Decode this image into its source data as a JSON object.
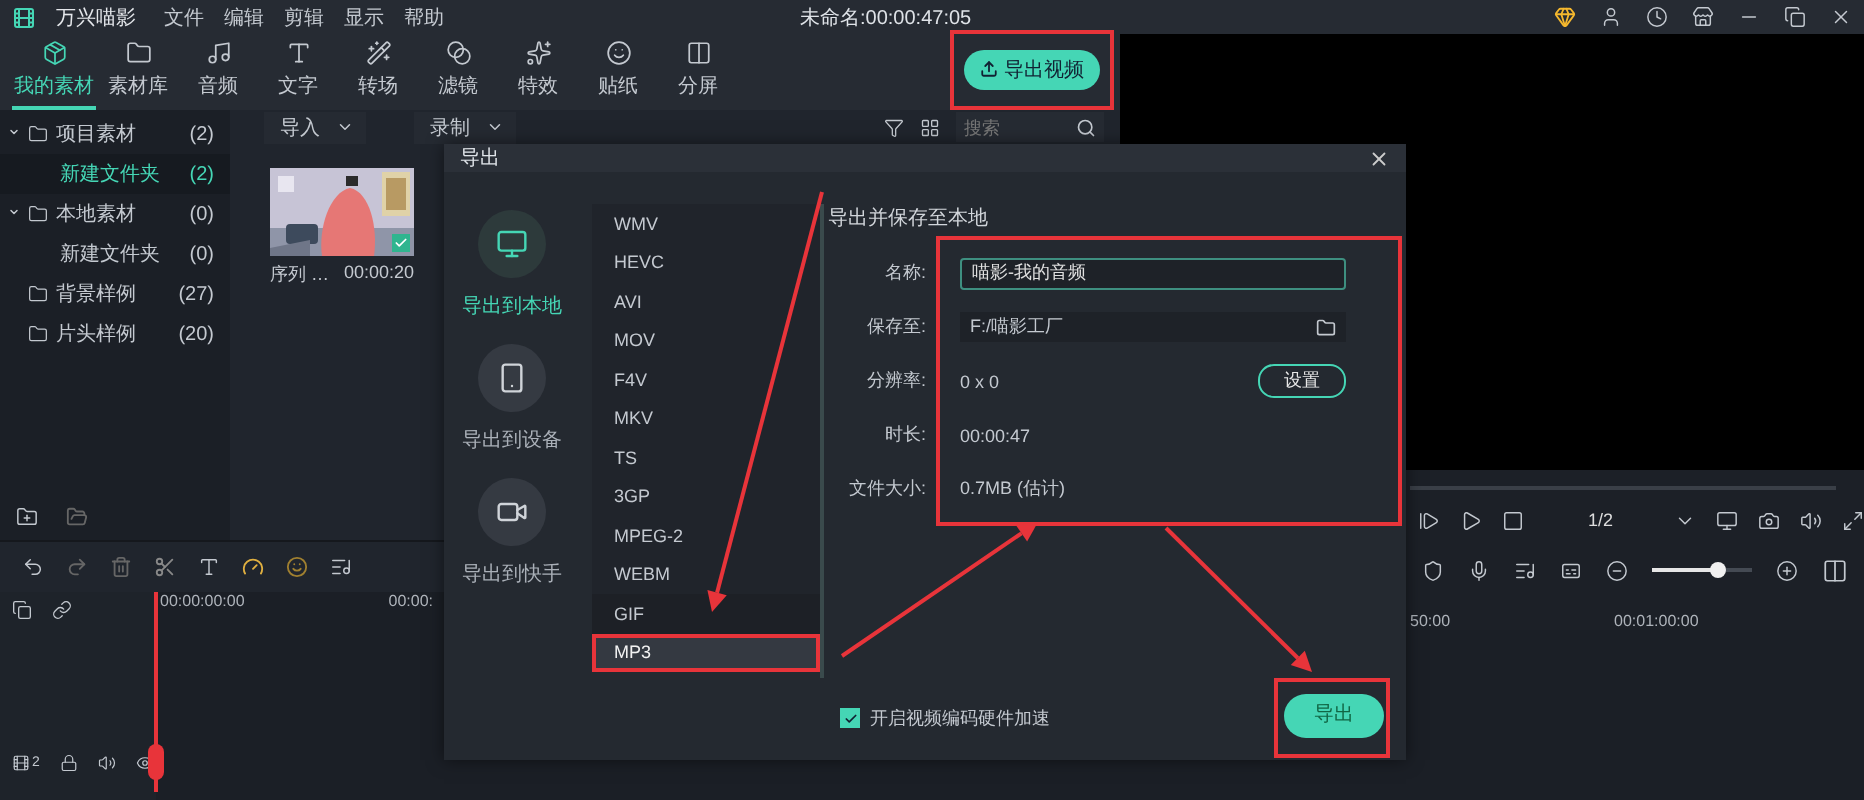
{
  "app": {
    "name": "万兴喵影",
    "menus": [
      "文件",
      "编辑",
      "剪辑",
      "显示",
      "帮助"
    ],
    "title": "未命名:00:00:47:05"
  },
  "toolbar": {
    "tabs": [
      {
        "label": "我的素材",
        "selected": true,
        "kind": "media"
      },
      {
        "label": "素材库",
        "selected": false,
        "kind": "library"
      },
      {
        "label": "音频",
        "selected": false,
        "kind": "audio"
      },
      {
        "label": "文字",
        "selected": false,
        "kind": "text"
      },
      {
        "label": "转场",
        "selected": false,
        "kind": "transition"
      },
      {
        "label": "滤镜",
        "selected": false,
        "kind": "filter"
      },
      {
        "label": "特效",
        "selected": false,
        "kind": "effect"
      },
      {
        "label": "贴纸",
        "selected": false,
        "kind": "sticker"
      },
      {
        "label": "分屏",
        "selected": false,
        "kind": "split"
      }
    ],
    "export_button": {
      "label": "导出视频",
      "highlighted": true
    }
  },
  "sidebar": {
    "items": [
      {
        "label": "项目素材",
        "count": "(2)",
        "expanded": true,
        "selected": false,
        "children": [
          {
            "label": "新建文件夹",
            "count": "(2)",
            "selected": true
          }
        ]
      },
      {
        "label": "本地素材",
        "count": "(0)",
        "expanded": true,
        "selected": false,
        "children": [
          {
            "label": "新建文件夹",
            "count": "(0)",
            "selected": false
          }
        ]
      },
      {
        "label": "背景样例",
        "count": "(27)",
        "expanded": false,
        "selected": false
      },
      {
        "label": "片头样例",
        "count": "(20)",
        "expanded": false,
        "selected": false
      }
    ]
  },
  "media": {
    "import": "导入",
    "record": "录制",
    "search": {
      "placeholder": "搜索"
    },
    "clips": [
      {
        "name": "序列 …",
        "duration": "00:00:20",
        "checked": true
      }
    ]
  },
  "timeline": {
    "ruler_left": [
      "00:00:00:00",
      "00:00:"
    ],
    "ruler_right": [
      "50:00",
      "00:01:00:00"
    ],
    "track_badge": "2"
  },
  "player": {
    "page": "1/2",
    "zoom": {
      "level": 0.65
    }
  },
  "dialog": {
    "title": "导出",
    "destinations": [
      {
        "label": "导出到本地",
        "selected": true,
        "kind": "local"
      },
      {
        "label": "导出到设备",
        "selected": false,
        "kind": "device"
      },
      {
        "label": "导出到快手",
        "selected": false,
        "kind": "kuaishou"
      }
    ],
    "video_formats": [
      {
        "label": "WMV",
        "selected": false,
        "highlighted": false
      },
      {
        "label": "HEVC",
        "selected": false,
        "highlighted": false
      },
      {
        "label": "AVI",
        "selected": false,
        "highlighted": false
      },
      {
        "label": "MOV",
        "selected": false,
        "highlighted": false
      },
      {
        "label": "F4V",
        "selected": false,
        "highlighted": false
      },
      {
        "label": "MKV",
        "selected": false,
        "highlighted": false
      },
      {
        "label": "TS",
        "selected": false,
        "highlighted": false
      },
      {
        "label": "3GP",
        "selected": false,
        "highlighted": false
      },
      {
        "label": "MPEG-2",
        "selected": false,
        "highlighted": false
      },
      {
        "label": "WEBM",
        "selected": false,
        "highlighted": false
      }
    ],
    "other_formats": [
      {
        "label": "GIF",
        "selected": false,
        "highlighted": false
      },
      {
        "label": "MP3",
        "selected": true,
        "highlighted": true
      }
    ],
    "heading": "导出并保存至本地",
    "fields_highlighted": true,
    "fields": [
      {
        "label": "名称:",
        "value": "喵影-我的音频",
        "kind": "input"
      },
      {
        "label": "保存至:",
        "value": "F:/喵影工厂",
        "kind": "folder"
      },
      {
        "label": "分辨率:",
        "value": "0 x 0",
        "kind": "setting",
        "button": "设置"
      },
      {
        "label": "时长:",
        "value": "00:00:47",
        "kind": "text"
      },
      {
        "label": "文件大小:",
        "value": "0.7MB (估计)",
        "kind": "text"
      }
    ],
    "hardware_accel": {
      "label": "开启视频编码硬件加速",
      "checked": true
    },
    "export_button": {
      "label": "导出",
      "highlighted": true
    }
  }
}
